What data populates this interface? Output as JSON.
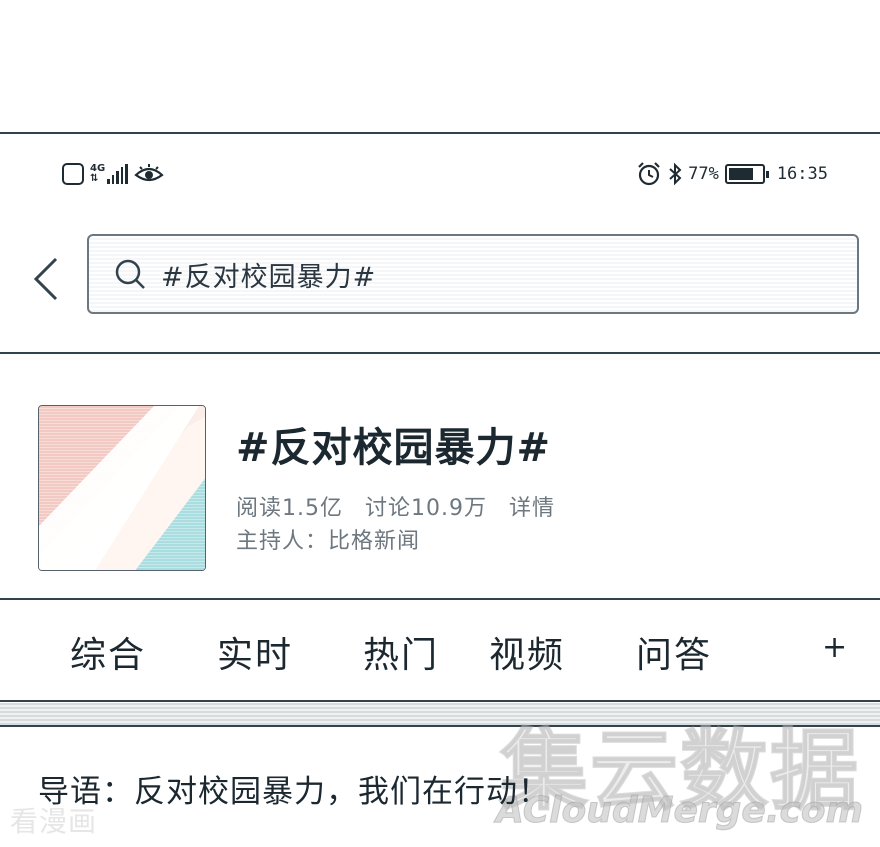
{
  "status_bar": {
    "network": "4G",
    "battery_percent": "77%",
    "battery_level": 0.77,
    "time": "16:35",
    "icons": [
      "square-icon",
      "signal-icon",
      "eye-icon",
      "alarm-icon",
      "bluetooth-icon",
      "battery-icon"
    ]
  },
  "search": {
    "query": "#反对校园暴力#",
    "icons": [
      "back-arrow-icon",
      "search-icon"
    ]
  },
  "topic": {
    "title": "#反对校园暴力#",
    "reads": "阅读1.5亿",
    "discussions": "讨论10.9万",
    "details_link": "详情",
    "host": "主持人：比格新闻"
  },
  "tabs": {
    "items": [
      "综合",
      "实时",
      "热门",
      "视频",
      "问答"
    ],
    "add_label": "+"
  },
  "post": {
    "intro": "导语：反对校园暴力，我们在行动！"
  },
  "watermarks": {
    "left": "看漫画",
    "right_big": "集云数据",
    "right_small": "ACloudMerge.com"
  },
  "colors": {
    "text": "#1f2b33",
    "meta": "#6d7780",
    "thumb_pink": "#f3c9c3",
    "thumb_cyan": "#a9dde0"
  }
}
